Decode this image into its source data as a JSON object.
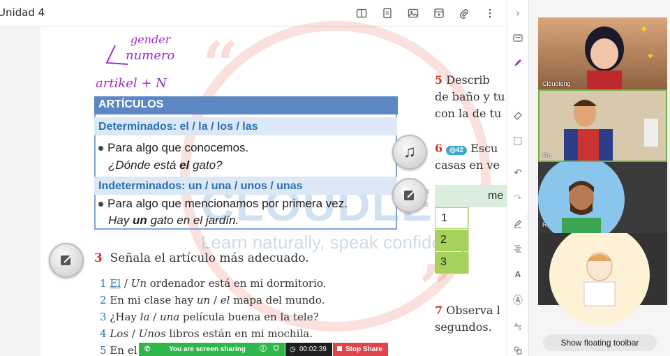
{
  "header": {
    "title": "Unidad 4"
  },
  "handwriting": {
    "line1": "gender",
    "line2": "numero",
    "line3": "artikel + N"
  },
  "articles": {
    "heading": "ARTÍCULOS",
    "determinados_label": "Determinados:",
    "determinados_forms": "el / la / los / las",
    "det_line1": "Para algo que conocemos.",
    "det_line2_a": "¿Dónde está ",
    "det_line2_b": "el",
    "det_line2_c": " gato?",
    "indeterminados_label": "Indeterminados:",
    "indeterminados_forms": "un / una / unos / unas",
    "ind_line1": "Para algo que mencionamos por primera vez.",
    "ind_line2_a": "Hay ",
    "ind_line2_b": "un",
    "ind_line2_c": " gato en el jardín."
  },
  "exercise3": {
    "number": "3",
    "title": "Señala el artículo más adecuado.",
    "items": [
      {
        "n": "1",
        "a": "El",
        "b": " / ",
        "c": "Un",
        "rest": " ordenador está en mi dormitorio."
      },
      {
        "n": "2",
        "pre": "En mi clase hay ",
        "a": "un",
        "b": " / ",
        "c": "el",
        "rest": " mapa del mundo."
      },
      {
        "n": "3",
        "pre": "¿Hay ",
        "a": "la",
        "b": " / ",
        "c": "una",
        "rest": " película buena en la tele?"
      },
      {
        "n": "4",
        "a": "Los",
        "b": " / ",
        "c": "Unos",
        "rest": " libros están en mi mochila."
      },
      {
        "n": "5",
        "pre": "En el",
        "a": "",
        "b": "",
        "c": "",
        "rest": ""
      }
    ]
  },
  "right_column": {
    "ex5_number": "5",
    "ex5_line1": "Describ",
    "ex5_line2": "de baño y tu",
    "ex5_line3": "con la de tu",
    "ex6_number": "6",
    "ex6_badge": "42",
    "ex6_line1": "Escu",
    "ex6_line2": "casas en ve",
    "table_header": "me",
    "rows": [
      "1",
      "2",
      "3"
    ],
    "ex7_number": "7",
    "ex7_line1": "Observa l",
    "ex7_line2": "segundos."
  },
  "watermark": {
    "brand": "CLOUDLENGUA",
    "tagline": "Learn naturally, speak confidently"
  },
  "video": {
    "tile1_label": "Cloudleng",
    "tile2_label": "Re",
    "tile3_label": "R",
    "floating_toolbar": "Show floating toolbar"
  },
  "share": {
    "message": "You are screen sharing",
    "timer": "00:02:39",
    "stop": "Stop Share"
  },
  "colors": {
    "blue": "#5b87c5",
    "red": "#d1362b",
    "green": "#a6d15b",
    "share_green": "#2eb84b",
    "stop_red": "#e0454c"
  }
}
